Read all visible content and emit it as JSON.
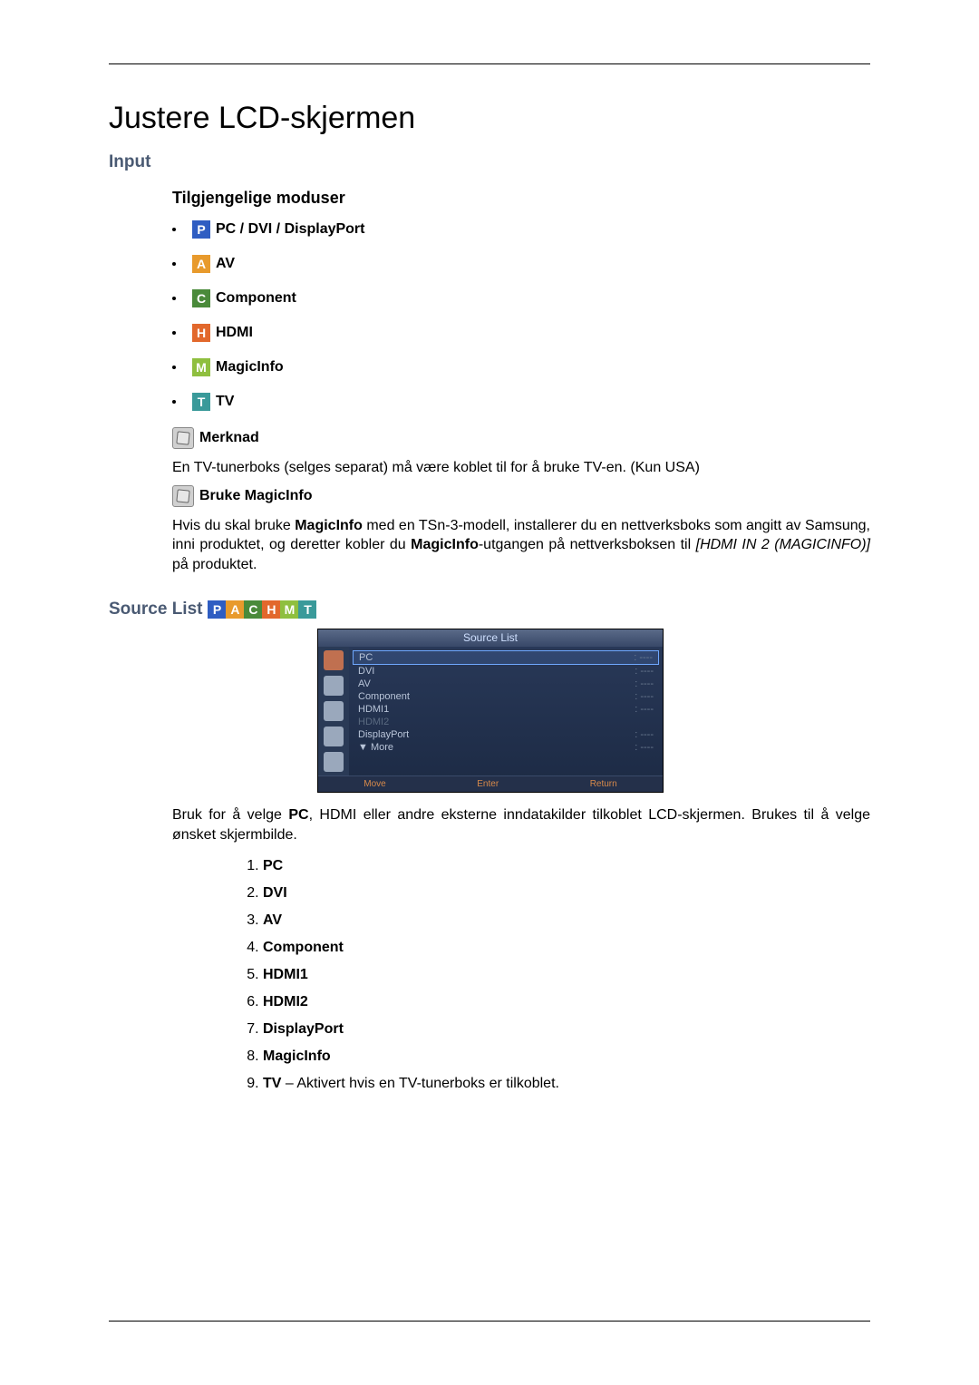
{
  "title": "Justere LCD-skjermen",
  "section_input": "Input",
  "subsection_modes": "Tilgjengelige moduser",
  "modes": {
    "p": {
      "letter": "P",
      "label": "PC / DVI / DisplayPort"
    },
    "a": {
      "letter": "A",
      "label": "AV"
    },
    "c": {
      "letter": "C",
      "label": "Component"
    },
    "h": {
      "letter": "H",
      "label": "HDMI"
    },
    "m": {
      "letter": "M",
      "label": "MagicInfo"
    },
    "t": {
      "letter": "T",
      "label": "TV"
    }
  },
  "note_label": "Merknad",
  "note_text": "En TV-tunerboks (selges separat) må være koblet til for å bruke TV-en. (Kun USA)",
  "magicinfo_label": "Bruke MagicInfo",
  "magicinfo_text_pre": "Hvis du skal bruke ",
  "magicinfo_text_b1": "MagicInfo",
  "magicinfo_text_mid": " med en TSn-3-modell, installerer du en nettverksboks som angitt av Samsung, inni produktet, og deretter kobler du ",
  "magicinfo_text_b2": "MagicInfo",
  "magicinfo_text_post": "-utgangen på nettverksboksen til ",
  "magicinfo_text_ref": "[HDMI IN 2 (MAGICINFO)]",
  "magicinfo_text_end": " på produktet.",
  "source_list_title": "Source List",
  "osd": {
    "title": "Source List",
    "rows": [
      {
        "name": "PC",
        "val": ": ----",
        "sel": true
      },
      {
        "name": "DVI",
        "val": ": ----"
      },
      {
        "name": "AV",
        "val": ": ----"
      },
      {
        "name": "Component",
        "val": ": ----"
      },
      {
        "name": "HDMI1",
        "val": ": ----"
      },
      {
        "name": "HDMI2",
        "val": "",
        "dim": true
      },
      {
        "name": "DisplayPort",
        "val": ": ----"
      },
      {
        "name": "▼ More",
        "val": ": ----"
      }
    ],
    "foot": {
      "move": "Move",
      "enter": "Enter",
      "return": "Return"
    }
  },
  "source_desc_pre": "Bruk for å velge ",
  "source_desc_b": "PC",
  "source_desc_post": ", HDMI eller andre eksterne inndatakilder tilkoblet LCD-skjermen. Brukes til å velge ønsket skjermbilde.",
  "numbered": {
    "1": "PC",
    "2": "DVI",
    "3": "AV",
    "4": "Component",
    "5": "HDMI1",
    "6": "HDMI2",
    "7": "DisplayPort",
    "8": "MagicInfo",
    "9b": "TV",
    "9t": " – Aktivert hvis en TV-tunerboks er tilkoblet."
  }
}
